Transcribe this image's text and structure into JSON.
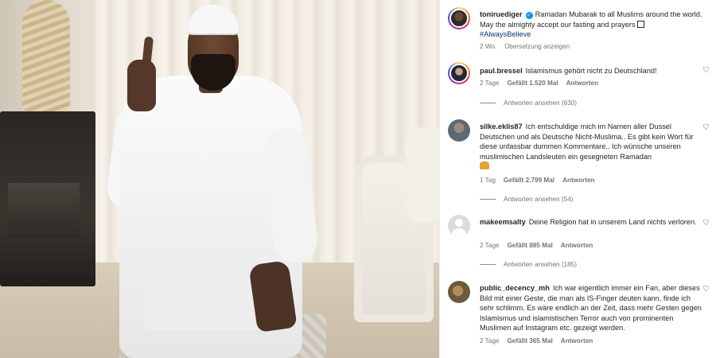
{
  "post": {
    "username": "toniruediger",
    "verified_mark": "✓",
    "caption": "Ramadan Mubarak to all Muslims around the world. May the almighty accept our fasting and prayers",
    "hashtag": "#AlwaysBelieve",
    "time": "2 Wo.",
    "translate": "Übersetzung anzeigen"
  },
  "comments": [
    {
      "username": "paul.bressel",
      "text": "Islamismus gehört nicht zu Deutschland!",
      "time": "2 Tage",
      "likes": "Gefällt 1.520 Mal",
      "reply": "Antworten",
      "view_replies": "Antworten ansehen (630)"
    },
    {
      "username": "silke.eklis87",
      "text": "Ich entschuldige mich im Namen aller Dussel Deutschen und als Deutsche Nicht-Muslima.. Es gibt kein Wort für diese unfassbar dummen Kommentare.. Ich wünsche unseren muslimischen Landsleuten ein gesegneten Ramadan",
      "time": "1 Tag",
      "likes": "Gefällt 2.799 Mal",
      "reply": "Antworten",
      "view_replies": "Antworten ansehen (54)"
    },
    {
      "username": "makeemsalty",
      "text": "Deine Religion hat in unserem Land nichts verloren.",
      "time": "2 Tage",
      "likes": "Gefällt 885 Mal",
      "reply": "Antworten",
      "view_replies": "Antworten ansehen (185)"
    },
    {
      "username": "public_decency_mh",
      "text": "Ich war eigentlich immer ein Fan, aber dieses Bild mit einer Geste, die man als IS-Finger deuten kann, finde ich sehr schlimm. Es wäre endlich an der Zeit, dass mehr Gesten gegen Islamismus und islamistischen Terror auch von prominenten Muslimen auf Instagram etc. gezeigt werden.",
      "time": "2 Tage",
      "likes": "Gefällt 365 Mal",
      "reply": "Antworten"
    }
  ],
  "icons": {
    "like": "heart-icon",
    "heart_glyph": "♡"
  }
}
